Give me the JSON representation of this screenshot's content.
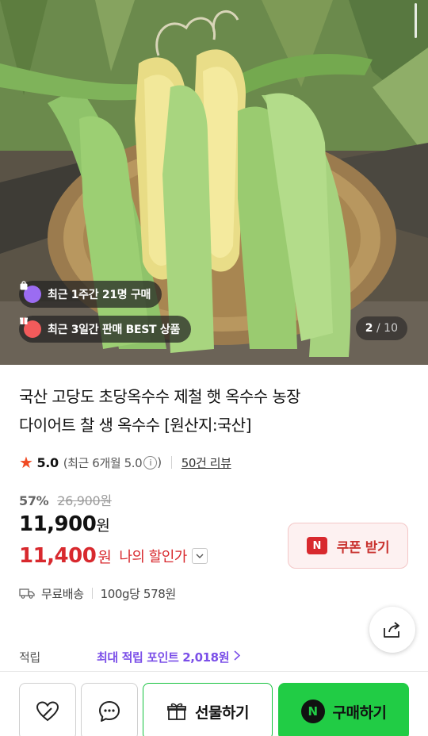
{
  "gallery": {
    "badge_recent_buyers": "최근 1주간 21명 구매",
    "badge_best": "최근 3일간 판매 BEST 상품",
    "current_index": "2",
    "total_count": "10"
  },
  "product": {
    "title_line1": "국산 고당도 초당옥수수 제철 햇 옥수수 농장",
    "title_line2": "다이어트 찰 생 옥수수 [원산지:국산]",
    "rating": "5.0",
    "rating_recent_text": "(최근 6개월 5.0",
    "rating_recent_close": ")",
    "info_symbol": "i",
    "review_count_text": "50건 리뷰",
    "discount_rate": "57%",
    "original_price": "26,900원",
    "price_number": "11,900",
    "price_unit": "원",
    "sale_price_number": "11,400",
    "sale_price_unit": "원",
    "my_discount_label": "나의 할인가",
    "coupon_label": "쿠폰 받기",
    "coupon_logo": "N",
    "shipping": "무료배송",
    "unit_price": "100g당 578원",
    "points_label": "적립",
    "points_link": "최대 적립 포인트 2,018원"
  },
  "actions": {
    "gift_label": "선물하기",
    "buy_label": "구매하기",
    "buy_logo": "N"
  },
  "colors": {
    "sale_red": "#d8292e",
    "points_purple": "#7b4fe8",
    "buy_green": "#21cc45"
  }
}
